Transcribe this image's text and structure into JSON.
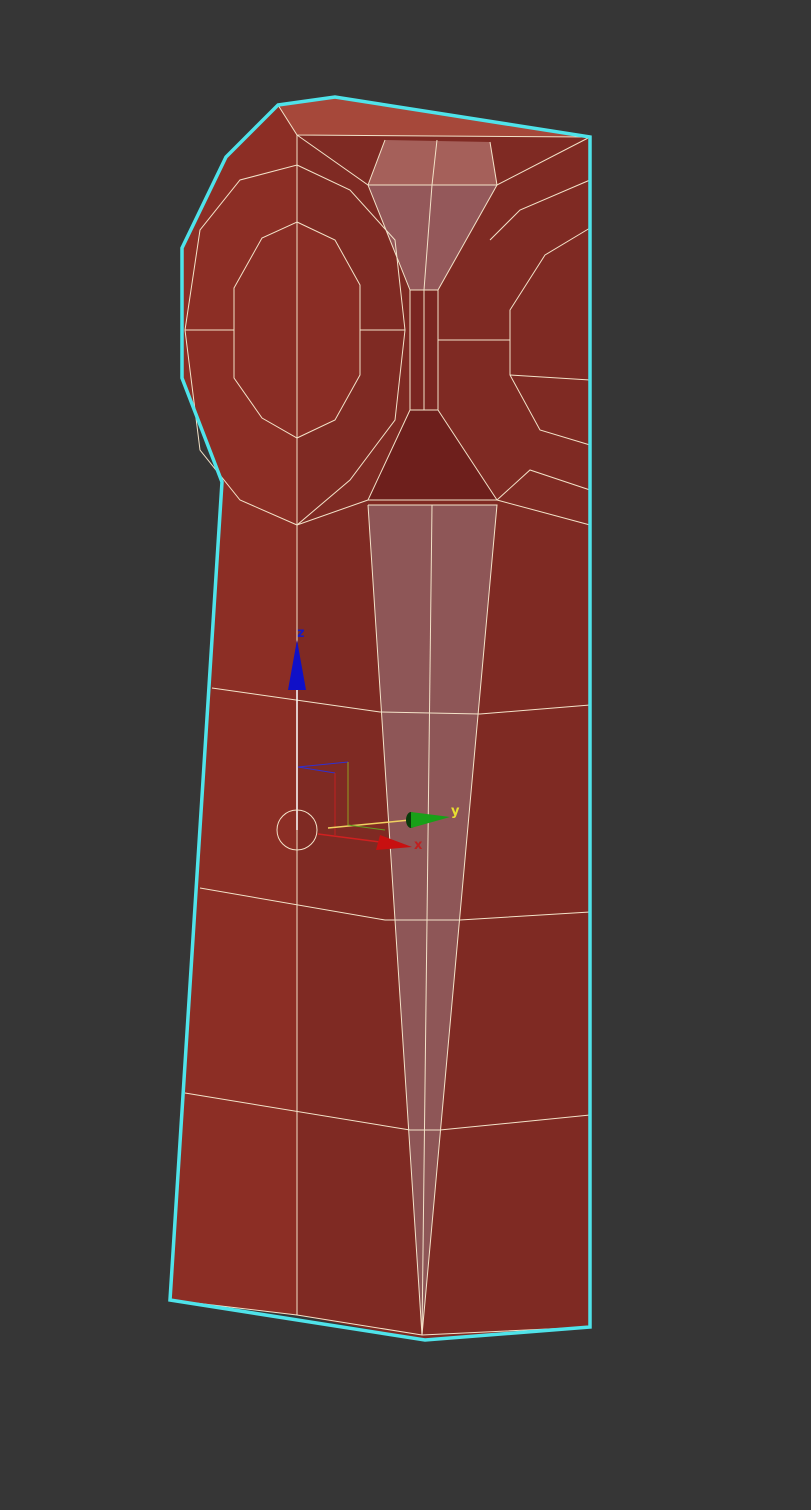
{
  "viewport": {
    "background": "#363636",
    "selection_outline_color": "#4FE3EA",
    "mesh_color": "#8B2D25",
    "wire_color": "#F3E2C8"
  },
  "gizmo": {
    "z_label": "z",
    "y_label": "y",
    "x_label": "x",
    "z_color": "#1010C0",
    "y_color": "#10A010",
    "x_color": "#C01010"
  }
}
